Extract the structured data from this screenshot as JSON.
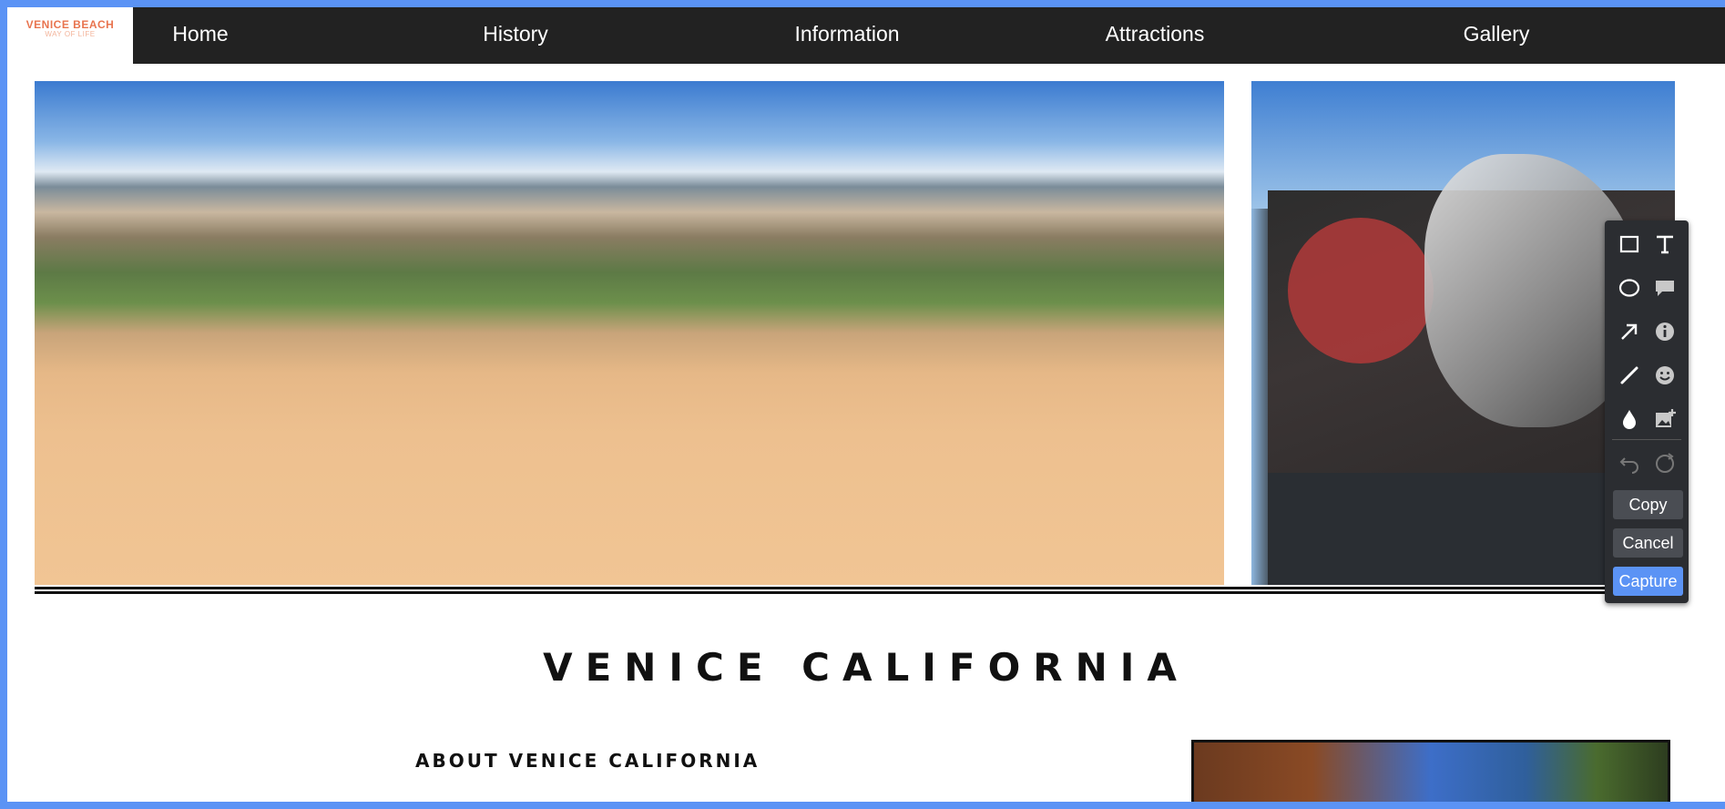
{
  "nav": {
    "logo_line1": "VENICE BEACH",
    "logo_line2": "WAY OF LIFE",
    "items": [
      "Home",
      "History",
      "Information",
      "Attractions",
      "Gallery"
    ]
  },
  "page": {
    "headline": "VENICE CALIFORNIA",
    "subheading": "ABOUT VENICE CALIFORNIA"
  },
  "toolbar": {
    "tools": [
      "rectangle-icon",
      "text-icon",
      "ellipse-icon",
      "comment-icon",
      "arrow-icon",
      "info-icon",
      "pencil-icon",
      "emoji-icon",
      "blur-drop-icon",
      "add-image-icon",
      "undo-icon",
      "redo-icon"
    ],
    "copy_label": "Copy",
    "cancel_label": "Cancel",
    "capture_label": "Capture"
  },
  "colors": {
    "nav_bg": "#222222",
    "accent": "#5b93f5",
    "logo": "#e8744f",
    "toolbar_bg": "#2b2d31"
  }
}
